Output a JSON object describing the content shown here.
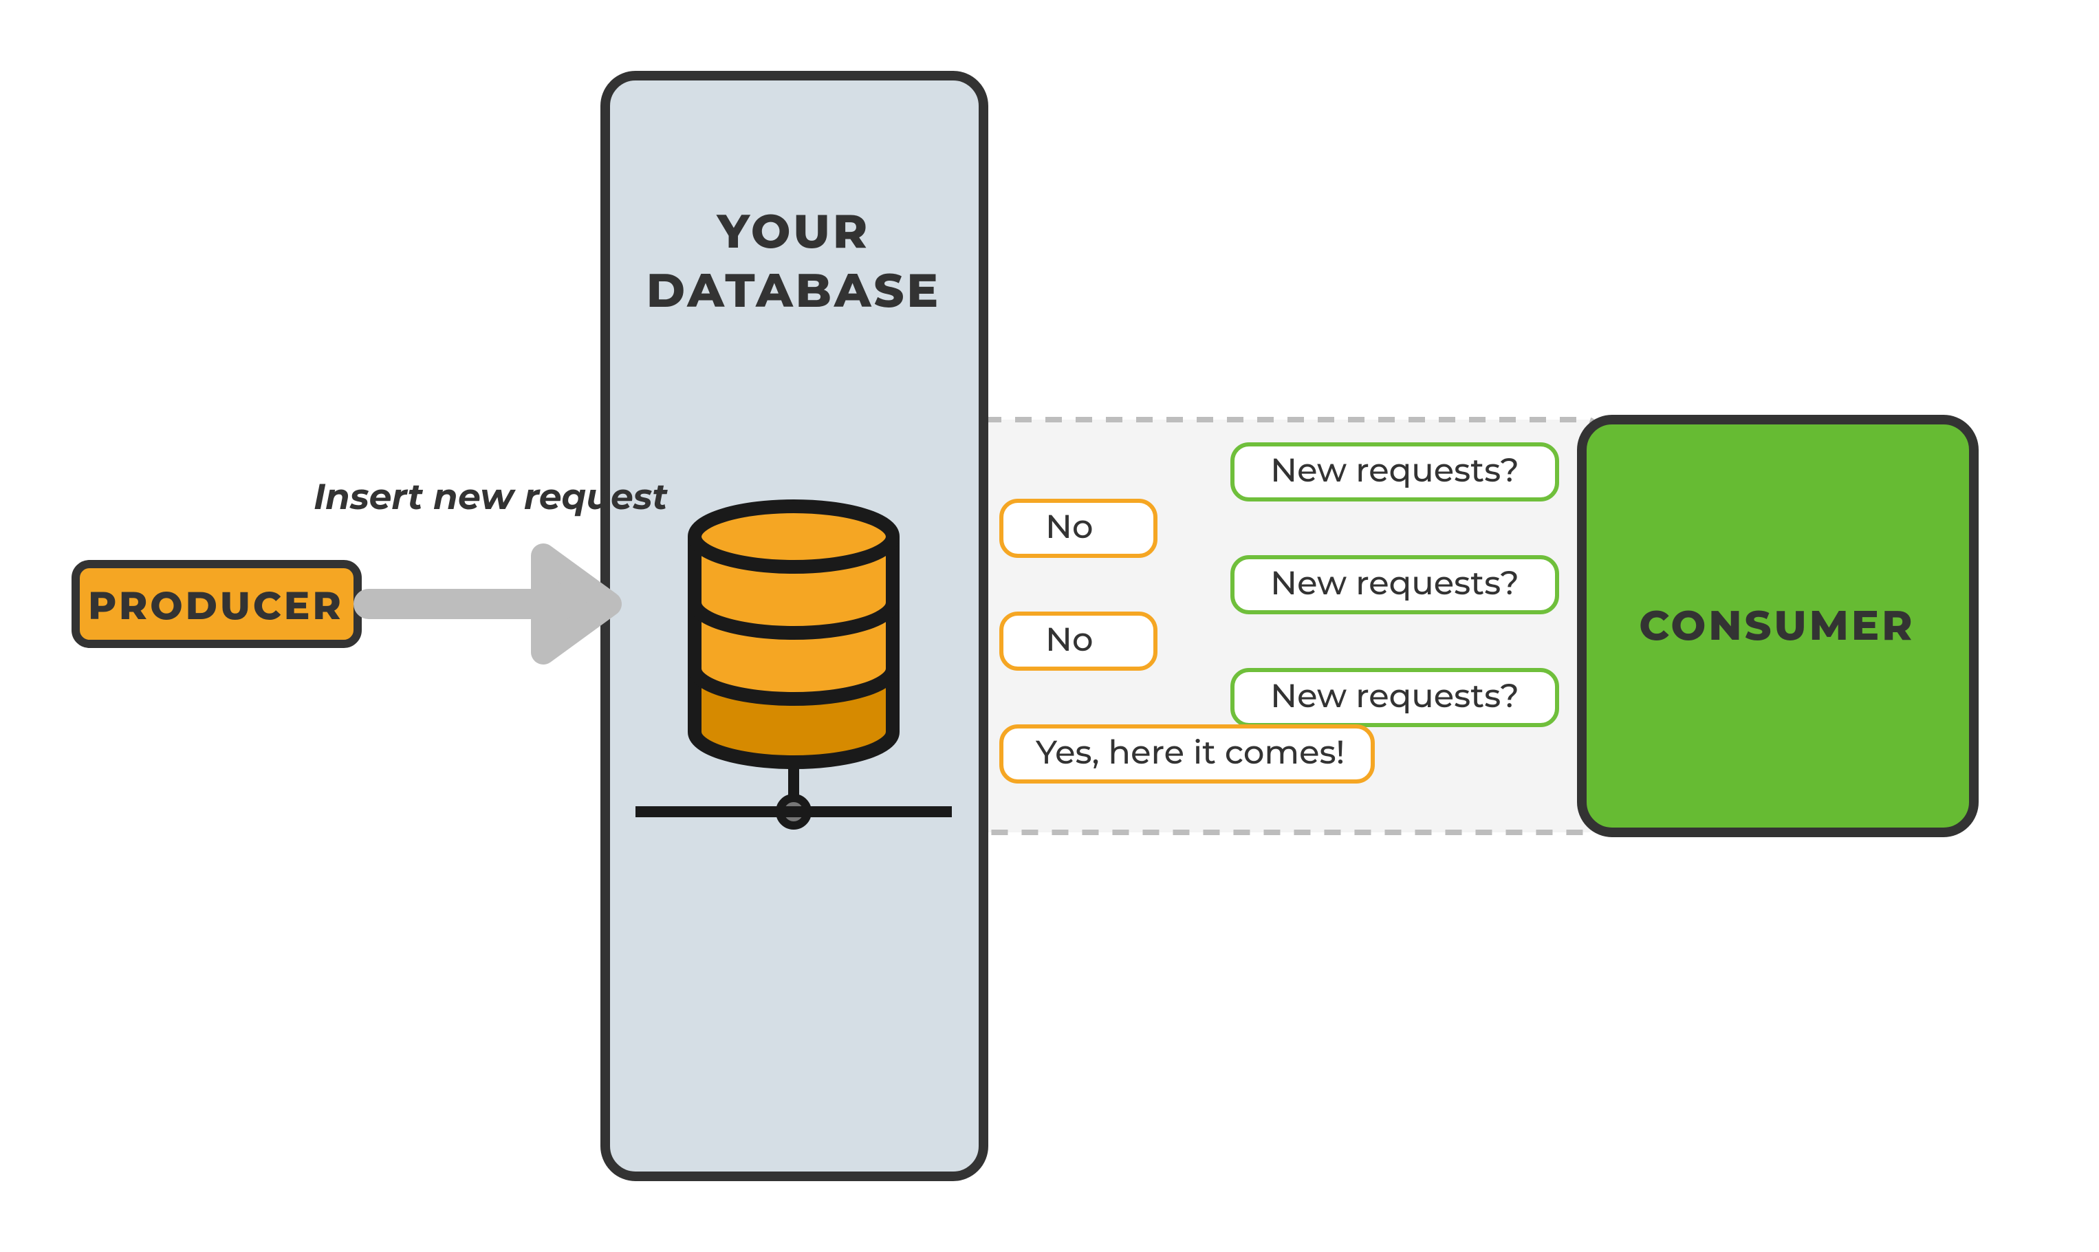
{
  "producer": {
    "label": "PRODUCER"
  },
  "consumer": {
    "label": "CONSUMER"
  },
  "database": {
    "title_line1": "YOUR",
    "title_line2": "DATABASE"
  },
  "edge": {
    "insert_label": "Insert new request"
  },
  "dialogue": {
    "ask1": "New requests?",
    "ans1": "No",
    "ask2": "New requests?",
    "ans2": "No",
    "ask3": "New requests?",
    "ans3": "Yes, here it comes!"
  },
  "colors": {
    "producer_fill": "#F5A623",
    "producer_stroke": "#333333",
    "consumer_fill": "#66BB33",
    "consumer_stroke": "#333333",
    "database_panel_fill": "#D5DEE5",
    "database_panel_stroke": "#333333",
    "db_cylinder_fill": "#F5A623",
    "db_cylinder_dark": "#D68A00",
    "arrow": "#BDBDBD",
    "channel_fill": "#F4F4F4",
    "channel_stroke": "#BDBDBD",
    "bubble_green": "#6FBF3B",
    "bubble_orange": "#F5A623",
    "bubble_bg": "#FFFFFF"
  }
}
